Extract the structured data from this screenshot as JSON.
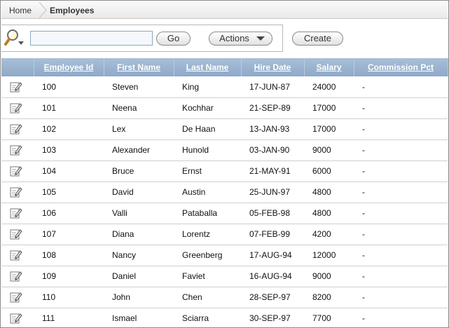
{
  "breadcrumb": {
    "home": "Home",
    "current": "Employees"
  },
  "search": {
    "value": "",
    "placeholder": ""
  },
  "toolbar": {
    "go_label": "Go",
    "actions_label": "Actions",
    "create_label": "Create"
  },
  "table": {
    "columns": [
      "Employee Id",
      "First Name",
      "Last Name",
      "Hire Date",
      "Salary",
      "Commission Pct"
    ],
    "rows": [
      [
        "100",
        "Steven",
        "King",
        "17-JUN-87",
        "24000",
        "-"
      ],
      [
        "101",
        "Neena",
        "Kochhar",
        "21-SEP-89",
        "17000",
        "-"
      ],
      [
        "102",
        "Lex",
        "De Haan",
        "13-JAN-93",
        "17000",
        "-"
      ],
      [
        "103",
        "Alexander",
        "Hunold",
        "03-JAN-90",
        "9000",
        "-"
      ],
      [
        "104",
        "Bruce",
        "Ernst",
        "21-MAY-91",
        "6000",
        "-"
      ],
      [
        "105",
        "David",
        "Austin",
        "25-JUN-97",
        "4800",
        "-"
      ],
      [
        "106",
        "Valli",
        "Pataballa",
        "05-FEB-98",
        "4800",
        "-"
      ],
      [
        "107",
        "Diana",
        "Lorentz",
        "07-FEB-99",
        "4200",
        "-"
      ],
      [
        "108",
        "Nancy",
        "Greenberg",
        "17-AUG-94",
        "12000",
        "-"
      ],
      [
        "109",
        "Daniel",
        "Faviet",
        "16-AUG-94",
        "9000",
        "-"
      ],
      [
        "110",
        "John",
        "Chen",
        "28-SEP-97",
        "8200",
        "-"
      ],
      [
        "111",
        "Ismael",
        "Sciarra",
        "30-SEP-97",
        "7700",
        "-"
      ]
    ]
  },
  "icons": {
    "search": "magnifier-icon",
    "edit": "pencil-edit-icon",
    "actions": "chevron-down-icon"
  },
  "colors": {
    "header_bg": "#98b0cd",
    "header_text": "#ffffff",
    "input_border": "#8aa7c2"
  }
}
